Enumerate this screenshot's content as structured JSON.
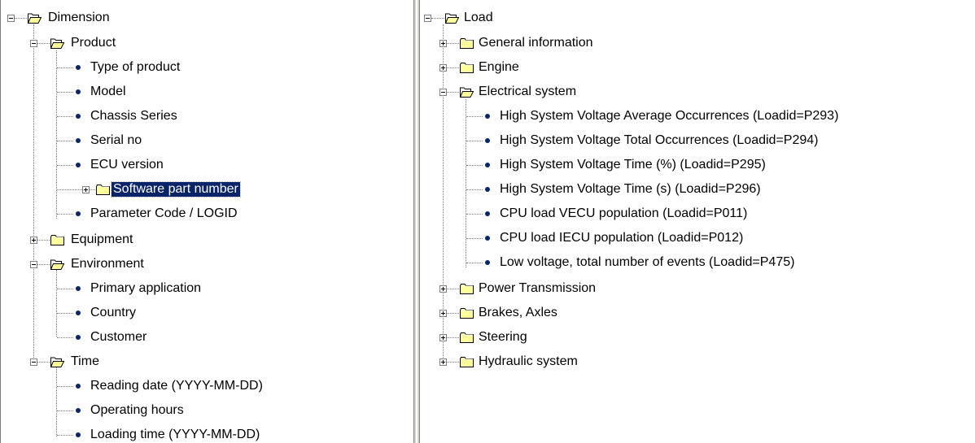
{
  "left_tree": {
    "root": "Dimension",
    "product": {
      "label": "Product",
      "items": [
        "Type of product",
        "Model",
        "Chassis Series",
        "Serial no",
        "ECU version"
      ],
      "software_part_number": "Software part number",
      "parameter_code": "Parameter Code / LOGID"
    },
    "equipment": "Equipment",
    "environment": {
      "label": "Environment",
      "items": [
        "Primary application",
        "Country",
        "Customer"
      ]
    },
    "time": {
      "label": "Time",
      "items": [
        "Reading date  (YYYY-MM-DD)",
        "Operating hours",
        "Loading time  (YYYY-MM-DD)"
      ]
    }
  },
  "right_tree": {
    "root": "Load",
    "general_information": "General information",
    "engine": "Engine",
    "electrical_system": {
      "label": "Electrical system",
      "items": [
        "High System Voltage Average Occurrences  (Loadid=P293)",
        "High System Voltage Total Occurrences  (Loadid=P294)",
        "High System Voltage Time (%)  (Loadid=P295)",
        "High System Voltage Time (s)  (Loadid=P296)",
        "CPU load VECU population  (Loadid=P011)",
        "CPU load IECU population  (Loadid=P012)",
        "Low voltage, total number of events  (Loadid=P475)"
      ]
    },
    "power_transmission": "Power Transmission",
    "brakes_axles": "Brakes, Axles",
    "steering": "Steering",
    "hydraulic_system": "Hydraulic system"
  },
  "colors": {
    "selection": "#0a246a",
    "folder_fill": "#ffff9c",
    "tree_line": "#808080",
    "splitter": "#d4d0c8"
  },
  "selected_node": "Software part number"
}
